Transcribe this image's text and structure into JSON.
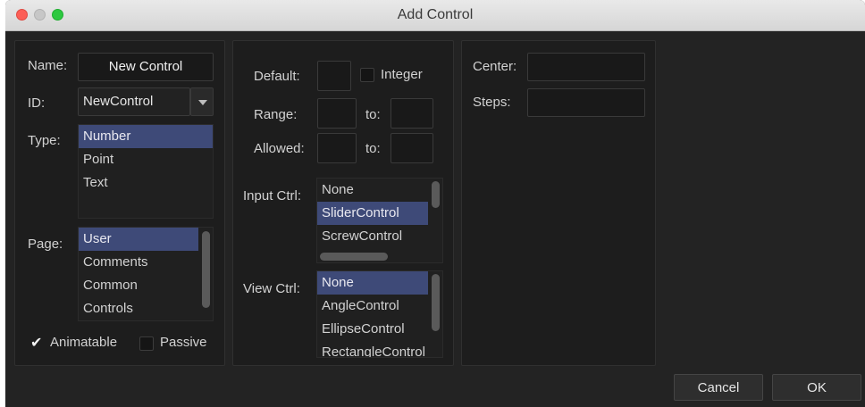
{
  "window": {
    "title": "Add Control"
  },
  "left_panel": {
    "name_label": "Name:",
    "name_value": "New Control",
    "id_label": "ID:",
    "id_value": "NewControl",
    "type_label": "Type:",
    "type_options": [
      "Number",
      "Point",
      "Text"
    ],
    "type_selected": "Number",
    "page_label": "Page:",
    "page_options": [
      "User",
      "Comments",
      "Common",
      "Controls"
    ],
    "page_selected": "User",
    "animatable_label": "Animatable",
    "animatable_checked": true,
    "passive_label": "Passive",
    "passive_checked": false
  },
  "middle_panel": {
    "default_label": "Default:",
    "default_value": "",
    "integer_label": "Integer",
    "integer_checked": false,
    "range_label": "Range:",
    "range_to_label": "to:",
    "allowed_label": "Allowed:",
    "allowed_to_label": "to:",
    "input_ctrl_label": "Input Ctrl:",
    "input_ctrl_options": [
      "None",
      "SliderControl",
      "ScrewControl"
    ],
    "input_ctrl_selected": "SliderControl",
    "view_ctrl_label": "View Ctrl:",
    "view_ctrl_options": [
      "None",
      "AngleControl",
      "EllipseControl",
      "RectangleControl"
    ],
    "view_ctrl_selected": "None"
  },
  "right_panel": {
    "center_label": "Center:",
    "steps_label": "Steps:"
  },
  "footer": {
    "cancel_label": "Cancel",
    "ok_label": "OK"
  },
  "colors": {
    "window_bg": "#232323",
    "panel_bg": "#1d1d1d",
    "selection": "#3e4a78",
    "titlebar": "#e0e0e0"
  },
  "icons": [
    "close-window-icon",
    "minimize-window-icon",
    "maximize-window-icon",
    "chevron-down-icon",
    "checkmark-icon"
  ]
}
